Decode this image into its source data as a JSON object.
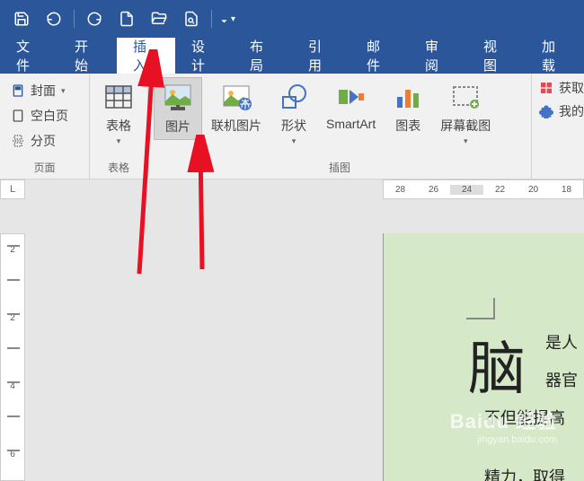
{
  "qat": {
    "save": "保存",
    "undo": "撤销",
    "redo": "重做",
    "new": "新建",
    "open": "打开",
    "preview": "打印预览",
    "more": "更多"
  },
  "tabs": [
    "文件",
    "开始",
    "插入",
    "设计",
    "布局",
    "引用",
    "邮件",
    "审阅",
    "视图",
    "加载"
  ],
  "tabs_active_index": 2,
  "ribbon": {
    "pages": {
      "cover": "封面",
      "blank": "空白页",
      "break": "分页",
      "group_label": "页面"
    },
    "tables": {
      "table": "表格",
      "group_label": "表格"
    },
    "illustrations": {
      "picture": "图片",
      "online_picture": "联机图片",
      "shapes": "形状",
      "smartart": "SmartArt",
      "chart": "图表",
      "screenshot": "屏幕截图",
      "group_label": "插图"
    },
    "right": {
      "get_addin": "获取",
      "my_addin": "我的"
    }
  },
  "ruler": {
    "corner": "L",
    "h_ticks": [
      "28",
      "26",
      "24",
      "22",
      "20",
      "18"
    ],
    "v_ticks": [
      "2",
      "",
      "2",
      "",
      "4",
      "",
      "6"
    ]
  },
  "document": {
    "drop_cap": "脑",
    "line1": "是人",
    "line2": "器官",
    "line3": "不但能提高",
    "line4": "精力，取得"
  },
  "watermark": {
    "main": "Baidu 经验",
    "sub": "jingyan.baidu.com"
  }
}
